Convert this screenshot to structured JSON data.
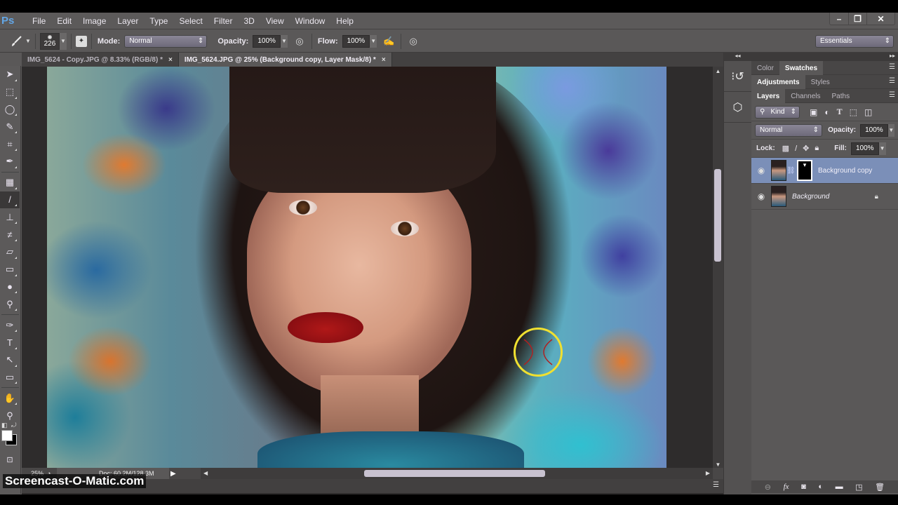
{
  "app": {
    "logo": "Ps",
    "menu": [
      "File",
      "Edit",
      "Image",
      "Layer",
      "Type",
      "Select",
      "Filter",
      "3D",
      "View",
      "Window",
      "Help"
    ],
    "window_controls": {
      "minimize": "–",
      "restore": "❐",
      "close": "✕"
    }
  },
  "options_bar": {
    "tool_icon": "brush-icon",
    "brush_size": "226",
    "mode_label": "Mode:",
    "mode_value": "Normal",
    "opacity_label": "Opacity:",
    "opacity_value": "100%",
    "flow_label": "Flow:",
    "flow_value": "100%",
    "workspace": "Essentials"
  },
  "document_tabs": [
    {
      "title": "IMG_5624 - Copy.JPG @ 8.33% (RGB/8) *",
      "close": "×",
      "active": false
    },
    {
      "title": "IMG_5624.JPG @ 25% (Background copy, Layer Mask/8) *",
      "close": "×",
      "active": true
    }
  ],
  "tools": [
    {
      "name": "move-tool",
      "glyph": "➤"
    },
    {
      "name": "marquee-tool",
      "glyph": "⬚"
    },
    {
      "name": "lasso-tool",
      "glyph": "◯"
    },
    {
      "name": "quick-selection-tool",
      "glyph": "✎"
    },
    {
      "name": "crop-tool",
      "glyph": "⌗"
    },
    {
      "name": "eyedropper-tool",
      "glyph": "✒"
    },
    {
      "name": "spot-healing-tool",
      "glyph": "▦"
    },
    {
      "name": "brush-tool",
      "glyph": "/"
    },
    {
      "name": "clone-stamp-tool",
      "glyph": "⊥"
    },
    {
      "name": "history-brush-tool",
      "glyph": "≠"
    },
    {
      "name": "eraser-tool",
      "glyph": "▱"
    },
    {
      "name": "gradient-tool",
      "glyph": "▭"
    },
    {
      "name": "blur-tool",
      "glyph": "💧"
    },
    {
      "name": "dodge-tool",
      "glyph": "⚲"
    },
    {
      "name": "pen-tool",
      "glyph": "✑"
    },
    {
      "name": "type-tool",
      "glyph": "T"
    },
    {
      "name": "path-selection-tool",
      "glyph": "↖"
    },
    {
      "name": "rectangle-tool",
      "glyph": "▭"
    },
    {
      "name": "hand-tool",
      "glyph": "✋"
    },
    {
      "name": "zoom-tool",
      "glyph": "🔍"
    }
  ],
  "status": {
    "zoom": "25%",
    "doc_info": "Doc: 60.2M/128.3M"
  },
  "panels": {
    "group1_tabs": [
      "Color",
      "Swatches"
    ],
    "group1_active": "Swatches",
    "group2_tabs": [
      "Adjustments",
      "Styles"
    ],
    "group2_active": "Adjustments",
    "layers_tabs": [
      "Layers",
      "Channels",
      "Paths"
    ],
    "layers_active": "Layers",
    "filter_kind": "Kind",
    "blend_mode": "Normal",
    "opacity_label": "Opacity:",
    "opacity_value": "100%",
    "lock_label": "Lock:",
    "fill_label": "Fill:",
    "fill_value": "100%",
    "layers": [
      {
        "name": "Background copy",
        "visible": true,
        "has_mask": true,
        "selected": true,
        "locked": false
      },
      {
        "name": "Background",
        "visible": true,
        "has_mask": false,
        "selected": false,
        "locked": true
      }
    ],
    "footer_icons": [
      "link-layers-icon",
      "fx-icon",
      "add-mask-icon",
      "adjustment-layer-icon",
      "new-group-icon",
      "new-layer-icon",
      "delete-layer-icon"
    ]
  },
  "watermark": "Screencast-O-Matic.com"
}
